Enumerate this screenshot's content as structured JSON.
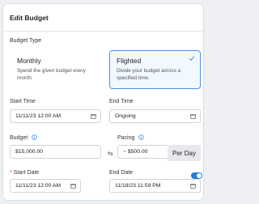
{
  "header": {
    "title": "Edit Budget"
  },
  "budget_type": {
    "label": "Budget Type",
    "options": [
      {
        "title": "Monthly",
        "description": "Spend the given budget every month.",
        "selected": false
      },
      {
        "title": "Flighted",
        "description": "Divide your budget across a specified time.",
        "selected": true
      }
    ]
  },
  "start_time": {
    "label": "Start Time",
    "value": "11/11/23 12:00 AM"
  },
  "end_time": {
    "label": "End Time",
    "value": "Ongoing"
  },
  "budget": {
    "label": "Budget",
    "value": "$15,000.00"
  },
  "pacing": {
    "label": "Pacing",
    "value": "~ $500.00",
    "unit": "Per Day"
  },
  "start_date": {
    "required_mark": "*",
    "label": "Start Date",
    "value": "11/11/23 12:00 AM"
  },
  "end_date": {
    "label": "End Date",
    "value": "11/18/23 11:59 PM",
    "toggle_on": true
  },
  "colors": {
    "accent": "#2b79d9",
    "selected_bg": "#f2f8ff",
    "border": "#cfd4db"
  }
}
